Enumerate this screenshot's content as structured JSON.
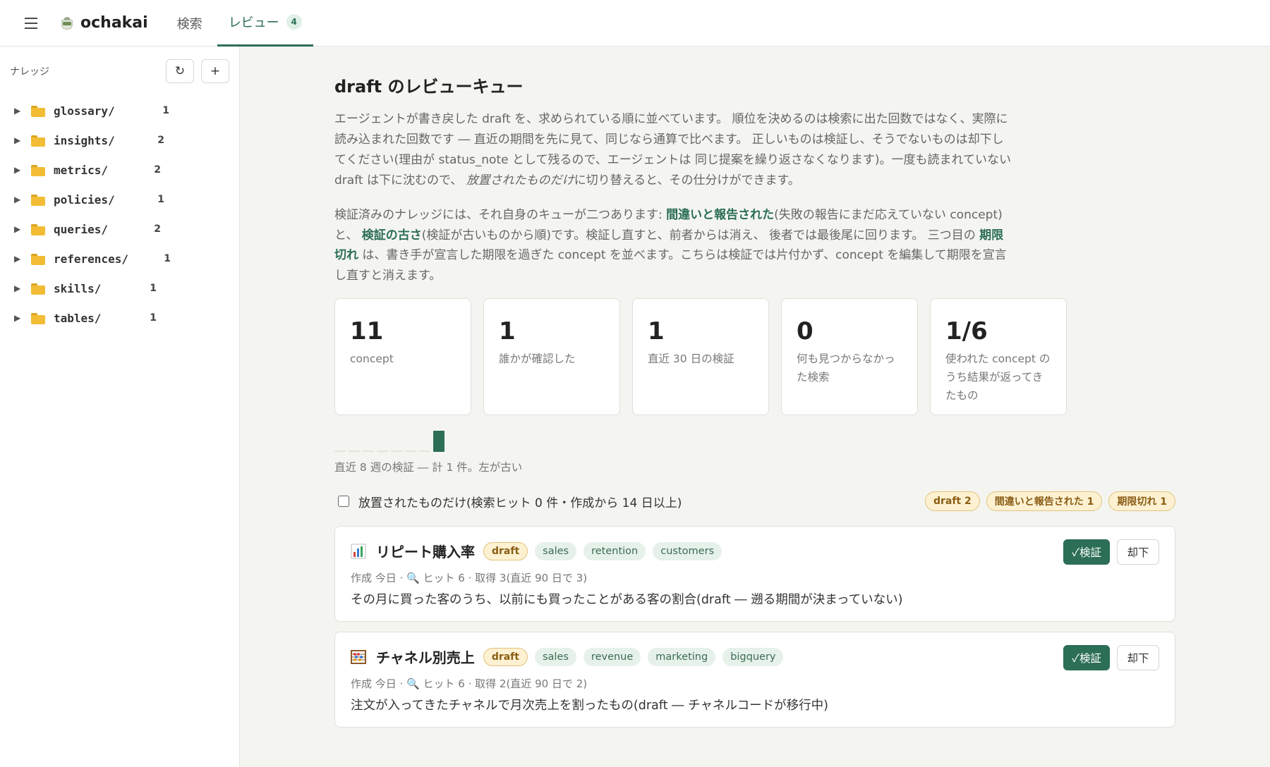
{
  "topbar": {
    "brand": "ochakai",
    "tabs": [
      {
        "label": "検索"
      },
      {
        "label": "レビュー",
        "badge": "4"
      }
    ]
  },
  "sidebar": {
    "title": "ナレッジ",
    "refresh_icon": "↻",
    "add_icon": "+",
    "folders": [
      {
        "name": "glossary/",
        "count": "1"
      },
      {
        "name": "insights/",
        "count": "2"
      },
      {
        "name": "metrics/",
        "count": "2"
      },
      {
        "name": "policies/",
        "count": "1"
      },
      {
        "name": "queries/",
        "count": "2"
      },
      {
        "name": "references/",
        "count": "1"
      },
      {
        "name": "skills/",
        "count": "1"
      },
      {
        "name": "tables/",
        "count": "1"
      }
    ]
  },
  "main": {
    "title": "draft のレビューキュー",
    "intro": {
      "p1": "エージェントが書き戻した draft を、求められている順に並べています。 順位を決めるのは検索に出た回数ではなく、実際に読み込まれた回数です ― 直近の期間を先に見て、同じなら通算で比べます。 正しいものは検証し、そうでないものは却下してください(理由が status_note として残るので、エージェントは 同じ提案を繰り返さなくなります)。一度も読まれていない draft は下に沈むので、",
      "p1_em": "放置されたものだけ",
      "p1_end": "に切り替えると、その仕分けができます。",
      "p2_a": "検証済みのナレッジには、それ自身のキューが二つあります: ",
      "p2_link1": "間違いと報告された",
      "p2_b": "(失敗の報告にまだ応えていない concept)と、 ",
      "p2_link2": "検証の古さ",
      "p2_c": "(検証が古いものから順)です。検証し直すと、前者からは消え、 後者では最後尾に回ります。 三つ目の ",
      "p2_link3": "期限切れ",
      "p2_d": " は、書き手が宣言した期限を過ぎた concept を並べます。こちらは検証では片付かず、concept を編集して期限を宣言し直すと消えます。"
    },
    "stats": [
      {
        "value": "11",
        "label": "concept"
      },
      {
        "value": "1",
        "label": "誰かが確認した"
      },
      {
        "value": "1",
        "label": "直近 30 日の検証"
      },
      {
        "value": "0",
        "label": "何も見つからなかった検索"
      },
      {
        "value": "1/6",
        "label": "使われた concept のうち結果が返ってきたもの"
      }
    ],
    "sparkline": {
      "weekly_counts": [
        0,
        0,
        0,
        0,
        0,
        0,
        0,
        1
      ],
      "caption": "直近 8 週の検証 ― 計 1 件。左が古い"
    },
    "filter": {
      "label": "放置されたものだけ(検索ヒット 0 件・作成から 14 日以上)",
      "checked": false,
      "pills": [
        "draft 2",
        "間違いと報告された 1",
        "期限切れ 1"
      ]
    },
    "cards": [
      {
        "icon": "chart-icon",
        "title": "リピート購入率",
        "status": "draft",
        "tags": [
          "sales",
          "retention",
          "customers"
        ],
        "meta": "作成 今日 · 🔍 ヒット 6 · 取得 3(直近 90 日で 3)",
        "description": "その月に買った客のうち、以前にも買ったことがある客の割合(draft ― 遡る期間が決まっていない)",
        "verify_label": "✓検証",
        "reject_label": "却下"
      },
      {
        "icon": "abacus-icon",
        "title": "チャネル別売上",
        "status": "draft",
        "tags": [
          "sales",
          "revenue",
          "marketing",
          "bigquery"
        ],
        "meta": "作成 今日 · 🔍 ヒット 6 · 取得 2(直近 90 日で 2)",
        "description": "注文が入ってきたチャネルで月次売上を割ったもの(draft ― チャネルコードが移行中)",
        "verify_label": "✓検証",
        "reject_label": "却下"
      }
    ]
  },
  "colors": {
    "accent": "#2c6e56",
    "draft_bg": "#fdf1d2",
    "draft_text": "#8a5d14",
    "tag_bg": "#e6f1ea"
  }
}
